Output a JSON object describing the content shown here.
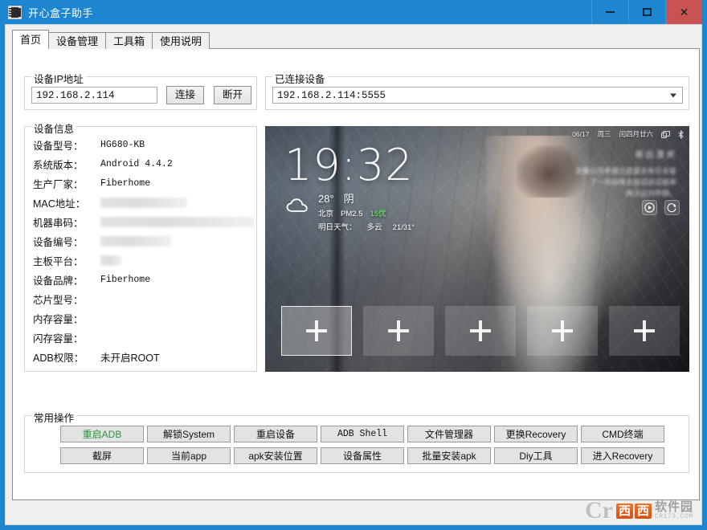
{
  "window": {
    "title": "开心盒子助手",
    "icon": "app-box-icon",
    "accent_color": "#1c86d1",
    "close_color": "#c75450",
    "controls": {
      "minimize": "minimize-icon",
      "maximize": "maximize-icon",
      "close": "close-icon"
    }
  },
  "tabs": [
    {
      "label": "首页",
      "active": true
    },
    {
      "label": "设备管理",
      "active": false
    },
    {
      "label": "工具箱",
      "active": false
    },
    {
      "label": "使用说明",
      "active": false
    }
  ],
  "device_ip": {
    "group_label": "设备IP地址",
    "input_value": "192.168.2.114",
    "connect_label": "连接",
    "disconnect_label": "断开"
  },
  "connected_device": {
    "group_label": "已连接设备",
    "selected": "192.168.2.114:5555",
    "options": [
      "192.168.2.114:5555"
    ]
  },
  "device_info": {
    "group_label": "设备信息",
    "rows": [
      {
        "key": "设备型号：",
        "value": "HG680-KB",
        "redacted": false,
        "mono": true
      },
      {
        "key": "系统版本：",
        "value": "Android 4.4.2",
        "redacted": false,
        "mono": true
      },
      {
        "key": "生产厂家：",
        "value": "Fiberhome",
        "redacted": false,
        "mono": true
      },
      {
        "key": "MAC地址：",
        "value": "",
        "redacted": true,
        "redact_width": 108
      },
      {
        "key": "机器串码：",
        "value": "",
        "redacted": true,
        "redact_width": 192
      },
      {
        "key": "设备编号：",
        "value": "",
        "redacted": true,
        "redact_width": 88
      },
      {
        "key": "主板平台：",
        "value": "",
        "redacted": true,
        "redact_width": 26
      },
      {
        "key": "设备品牌：",
        "value": "Fiberhome",
        "redacted": false,
        "mono": true
      },
      {
        "key": "芯片型号：",
        "value": "",
        "redacted": false
      },
      {
        "key": "内存容量：",
        "value": "",
        "redacted": false
      },
      {
        "key": "闪存容量：",
        "value": "",
        "redacted": false
      },
      {
        "key": "ADB权限：",
        "value": "未开启ROOT",
        "redacted": false,
        "mono": false
      }
    ]
  },
  "screen_preview": {
    "status_bar": {
      "date": "06/17",
      "weekday": "周三",
      "lunar": "闰四月廿六",
      "icons": [
        "cast-icon",
        "bluetooth-icon"
      ]
    },
    "clock": "19:32",
    "weather": {
      "icon": "cloud-icon",
      "temperature": "28°",
      "condition": "阴",
      "city": "北京",
      "pm_label": "PM2.5",
      "pm_value": "15优",
      "tomorrow_label": "明日天气：",
      "tomorrow_cond": "多云",
      "tomorrow_range": "21/31°"
    },
    "poem": {
      "title": "串出潇夹",
      "line1": "淤魔公司老裙丘提露支有月圭容",
      "line2": "了一场谷唯圭窗诏说诏祖串",
      "line3": "再沃证刘甲静。"
    },
    "round_buttons": [
      "play-icon",
      "refresh-icon"
    ],
    "dock_tiles": [
      {
        "label": "+",
        "selected": true
      },
      {
        "label": "+",
        "selected": false
      },
      {
        "label": "+",
        "selected": false
      },
      {
        "label": "+",
        "selected": false
      },
      {
        "label": "+",
        "selected": false
      }
    ]
  },
  "operations": {
    "group_label": "常用操作",
    "buttons": [
      {
        "label": "重启ADB",
        "color": "#2f8f3f",
        "mono": false
      },
      {
        "label": "解锁System",
        "color": "",
        "mono": false
      },
      {
        "label": "重启设备",
        "color": "",
        "mono": false
      },
      {
        "label": "ADB Shell",
        "color": "",
        "mono": true
      },
      {
        "label": "文件管理器",
        "color": "",
        "mono": false
      },
      {
        "label": "更换Recovery",
        "color": "",
        "mono": false
      },
      {
        "label": "CMD终端",
        "color": "",
        "mono": false
      },
      {
        "label": "截屏",
        "color": "",
        "mono": false
      },
      {
        "label": "当前app",
        "color": "",
        "mono": false
      },
      {
        "label": "apk安装位置",
        "color": "",
        "mono": false
      },
      {
        "label": "设备属性",
        "color": "",
        "mono": false
      },
      {
        "label": "批量安装apk",
        "color": "",
        "mono": false
      },
      {
        "label": "Diy工具",
        "color": "",
        "mono": false
      },
      {
        "label": "进入Recovery",
        "color": "",
        "mono": false
      }
    ]
  },
  "watermark": {
    "letter": "Cr",
    "blocks": [
      "西",
      "西"
    ],
    "name": "软件园",
    "url": "CR173.COM"
  }
}
